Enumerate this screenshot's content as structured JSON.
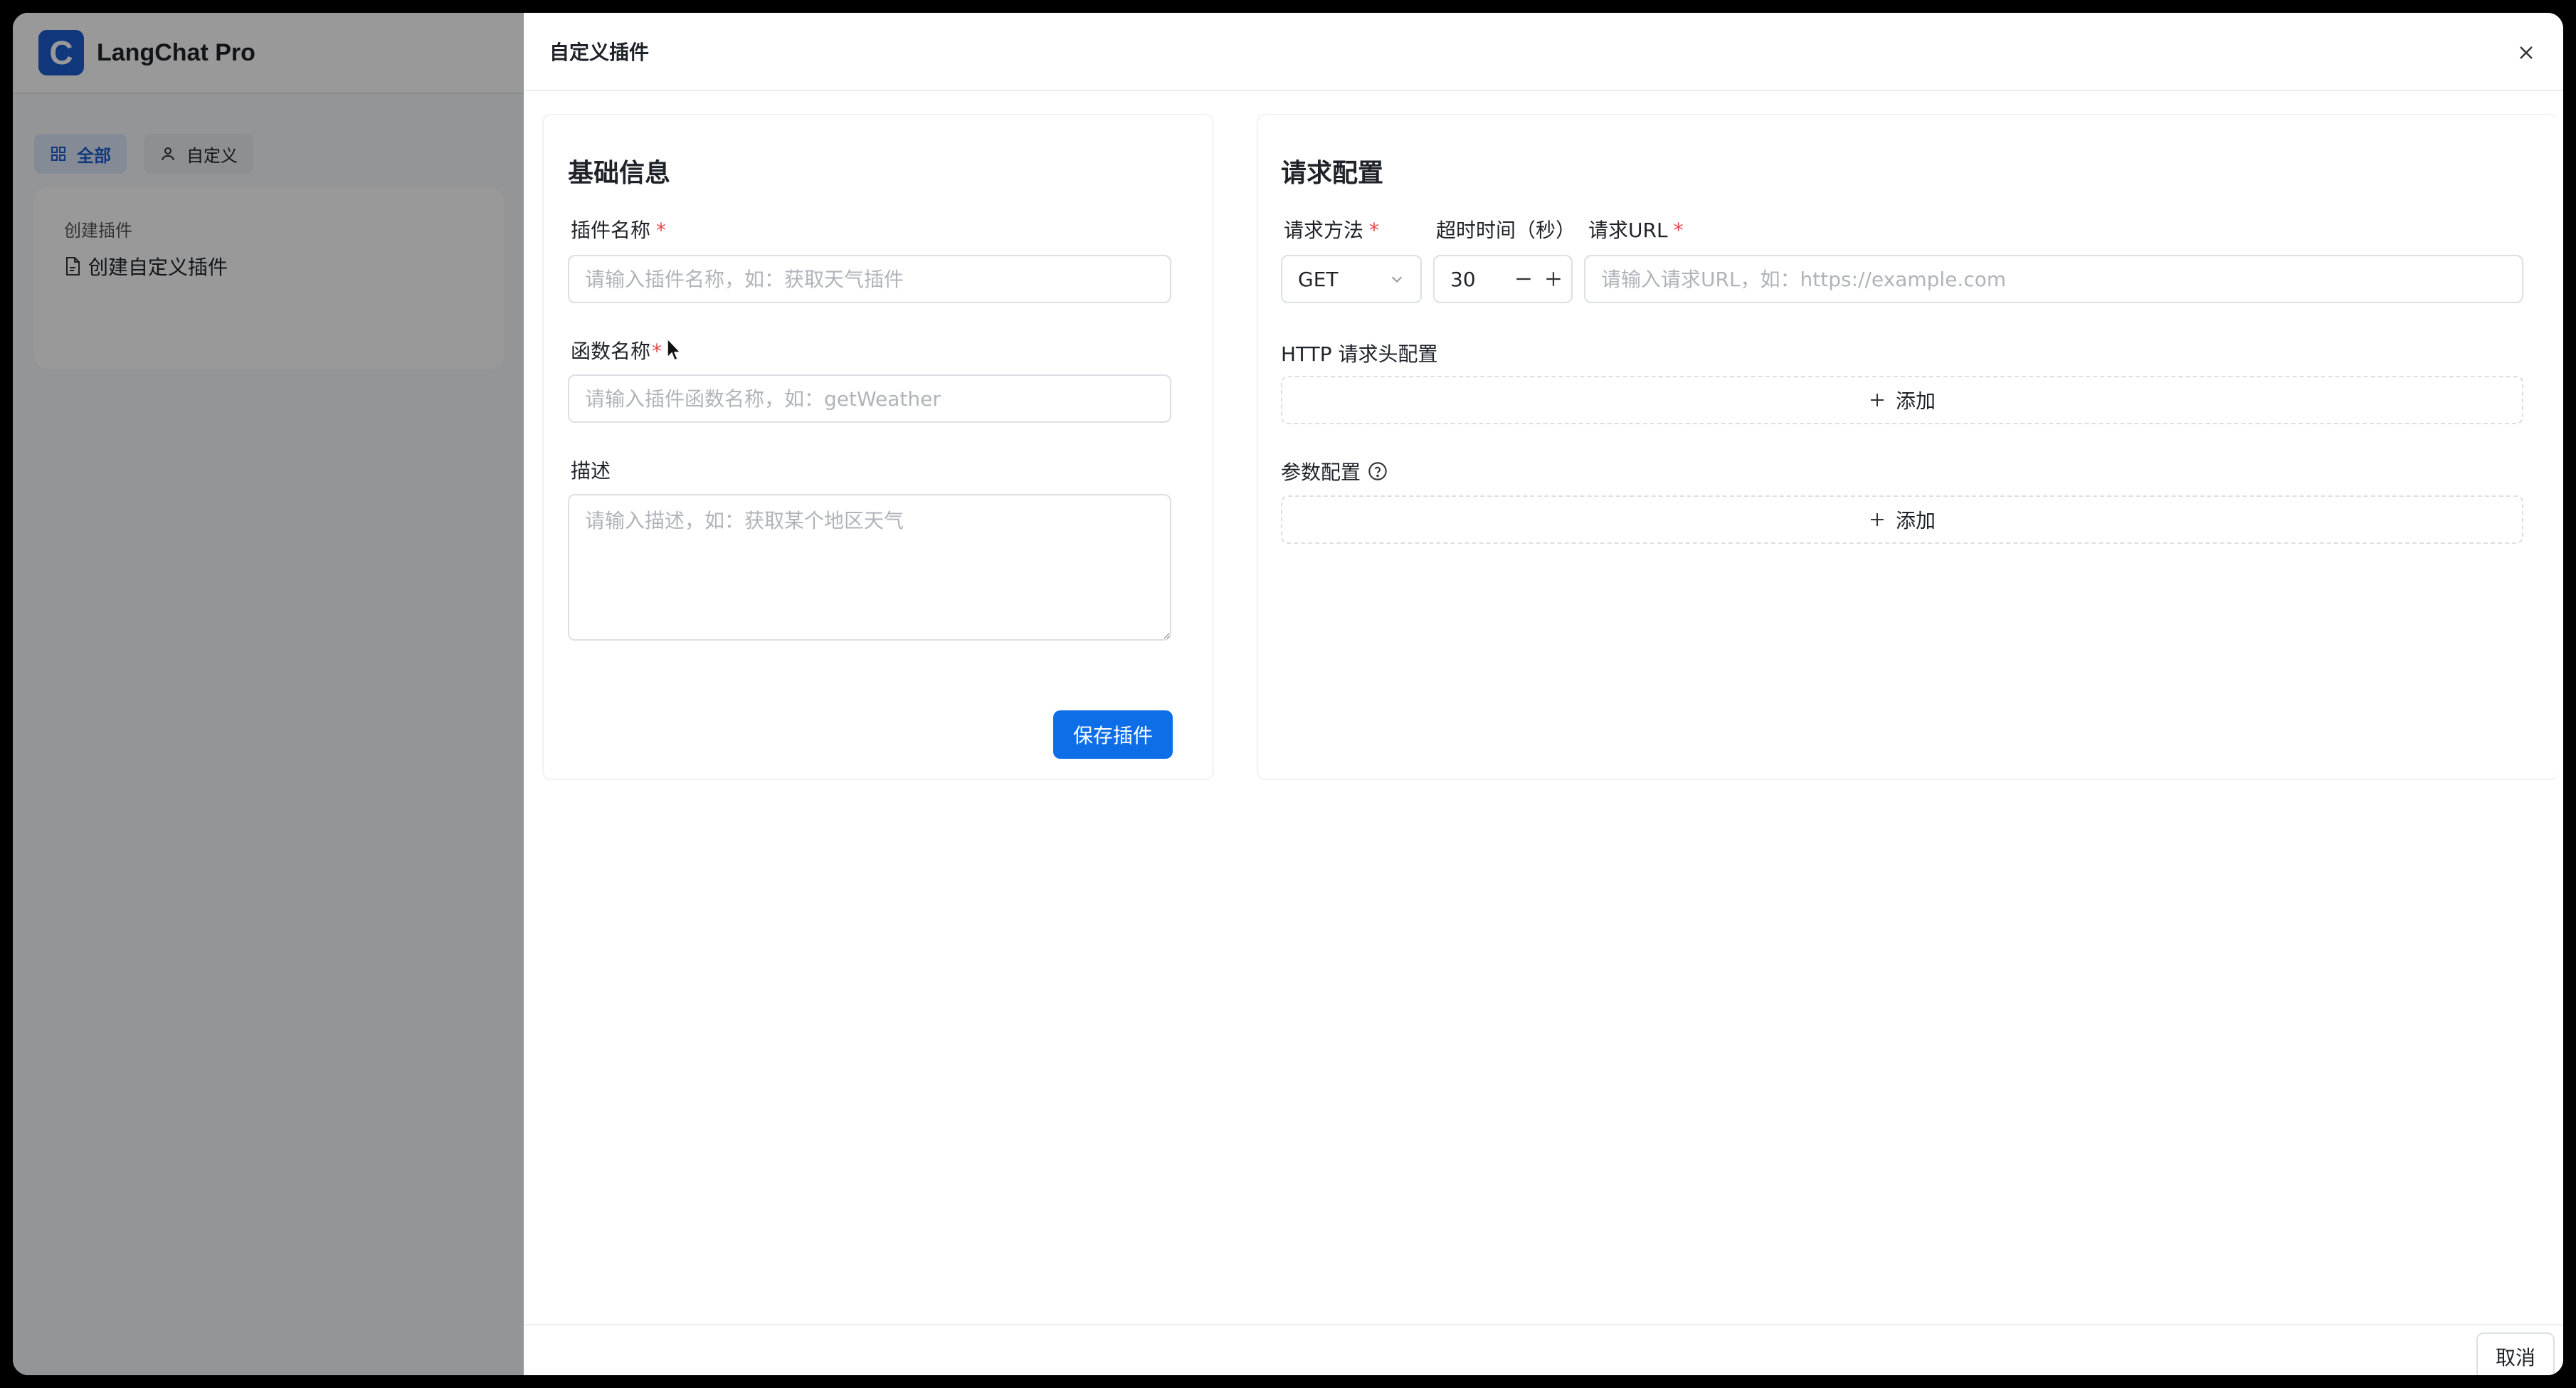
{
  "app": {
    "logo_letter": "C",
    "title": "LangChat Pro",
    "tabs": [
      {
        "label": "全部",
        "icon": "grid-icon",
        "active": true
      },
      {
        "label": "自定义",
        "icon": "user-icon",
        "active": false
      }
    ],
    "sidebar": {
      "section_title": "创建插件",
      "item_label": "创建自定义插件",
      "item_icon": "file-icon"
    }
  },
  "drawer": {
    "title": "自定义插件",
    "close_icon": "close-icon",
    "basic": {
      "title": "基础信息",
      "plugin_name_label": "插件名称",
      "plugin_name_placeholder": "请输入插件名称，如：获取天气插件",
      "function_name_label": "函数名称",
      "function_name_placeholder": "请输入插件函数名称，如：getWeather",
      "description_label": "描述",
      "description_placeholder": "请输入描述，如：获取某个地区天气",
      "save_label": "保存插件",
      "required_mark": "*"
    },
    "request": {
      "title": "请求配置",
      "method_label": "请求方法",
      "method_value": "GET",
      "timeout_label": "超时时间（秒）",
      "timeout_value": "30",
      "url_label": "请求URL",
      "url_placeholder": "请输入请求URL，如：https://example.com",
      "headers_label": "HTTP 请求头配置",
      "params_label": "参数配置",
      "add_label": "添加",
      "required_mark": "*"
    },
    "footer": {
      "cancel_label": "取消"
    }
  },
  "colors": {
    "primary": "#0e6ee8",
    "logo": "#1d5ecf",
    "required": "#e5484d"
  }
}
